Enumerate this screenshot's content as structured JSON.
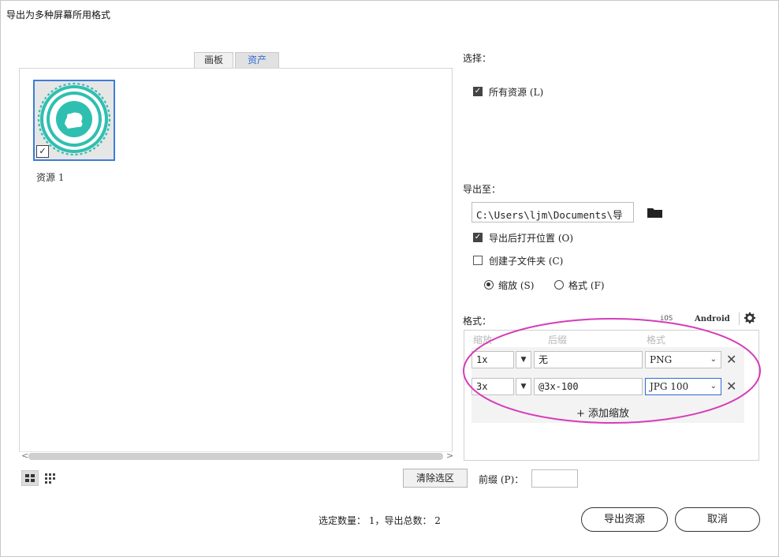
{
  "window": {
    "title": "导出为多种屏幕所用格式"
  },
  "tabs": {
    "artboards": "画板",
    "assets": "资产"
  },
  "asset": {
    "label": "资源 1",
    "check": "✓"
  },
  "scroll": {
    "left": "<",
    "right": ">"
  },
  "toolbar": {
    "clear_label": "清除选区",
    "prefix_label": "前缀 (P)：",
    "prefix_value": ""
  },
  "status": {
    "text": "选定数量： 1，导出总数： 2"
  },
  "actions": {
    "export_label": "导出资源",
    "cancel_label": "取消"
  },
  "select": {
    "title": "选择：",
    "all_assets": {
      "label": "所有资源 (L)",
      "checked": true,
      "mark": "✓"
    }
  },
  "export_to": {
    "title": "导出至：",
    "path": "C:\\Users\\ljm\\Documents\\导",
    "open_after": {
      "label": "导出后打开位置 (O)",
      "checked": true,
      "mark": "✓"
    },
    "subfolders": {
      "label": "创建子文件夹 (C)",
      "checked": false
    },
    "radio_scale": "缩放 (S)",
    "radio_format": "格式 (F)"
  },
  "formats": {
    "title": "格式：",
    "ios_label": "iOS",
    "android_label": "Android",
    "columns": {
      "scale": "缩放",
      "suffix": "后缀",
      "format": "格式"
    },
    "rows": [
      {
        "scale": "1x",
        "suffix": "无",
        "format": "PNG"
      },
      {
        "scale": "3x",
        "suffix": "@3x-100",
        "format": "JPG 100"
      }
    ],
    "add_scale": "+ 添加缩放",
    "remove": "✕",
    "chevron": "⌄",
    "dropdown": "▼"
  },
  "colors": {
    "accent": "#2f6ad6",
    "annotation": "#d63cb8",
    "thumb_border": "#3d7ed6"
  }
}
